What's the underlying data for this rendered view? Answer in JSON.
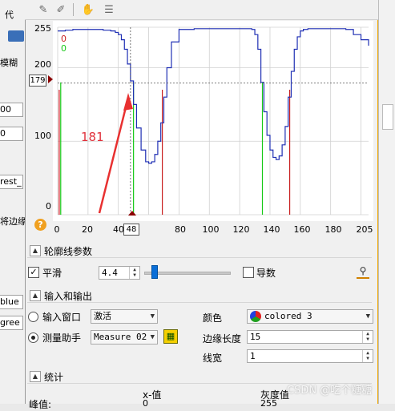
{
  "left_window": {
    "title_fragment": "代",
    "row_blur": "模糊",
    "field_1": "00",
    "field_2": "0",
    "field_3": "rest_",
    "row_edge": "将边缘",
    "field_blue": "blue",
    "field_green": "gree"
  },
  "toolbar": {
    "icons": [
      "pencil-icon",
      "eraser-icon",
      "hand-icon",
      "document-icon"
    ]
  },
  "plot": {
    "y_ticks": [
      "255",
      "200",
      "100",
      "0"
    ],
    "x_ticks": [
      "0",
      "20",
      "40",
      "60",
      "80",
      "100",
      "120",
      "140",
      "160",
      "180",
      "205"
    ],
    "y_marker_value": "179",
    "x_marker_value": "48",
    "label_red": "0",
    "label_green": "0",
    "annotation_text": "181",
    "help_icon": "help-icon",
    "colors": {
      "curve": "#1f2fb4",
      "green_line": "#16c816",
      "red_line": "#c81e1e",
      "annotation": "#e0303a",
      "arrow": "#e83030"
    }
  },
  "chart_data": {
    "type": "line",
    "xlim": [
      0,
      205
    ],
    "ylim": [
      0,
      255
    ],
    "grid": true,
    "x": [
      0,
      5,
      10,
      15,
      20,
      25,
      30,
      35,
      38,
      40,
      42,
      44,
      46,
      48,
      50,
      52,
      55,
      58,
      60,
      62,
      64,
      66,
      68,
      70,
      72,
      75,
      80,
      90,
      100,
      110,
      120,
      128,
      130,
      132,
      134,
      136,
      138,
      140,
      142,
      144,
      146,
      148,
      150,
      152,
      154,
      156,
      158,
      160,
      162,
      165,
      170,
      180,
      190,
      195,
      200,
      205
    ],
    "y": [
      250,
      251,
      252,
      252,
      252,
      252,
      251,
      250,
      248,
      245,
      238,
      225,
      205,
      182,
      150,
      118,
      88,
      72,
      70,
      72,
      82,
      100,
      125,
      160,
      200,
      235,
      252,
      253,
      253,
      253,
      253,
      252,
      245,
      225,
      180,
      140,
      108,
      88,
      78,
      75,
      80,
      95,
      120,
      160,
      195,
      225,
      242,
      250,
      252,
      253,
      253,
      253,
      252,
      245,
      238,
      230
    ],
    "green_lines_x": [
      2,
      50,
      135
    ],
    "red_lines_x": [
      1,
      69,
      153
    ]
  },
  "profile_section": {
    "title": "轮廓线参数",
    "smooth_checked": true,
    "smooth_label": "平滑",
    "smooth_value": "4.4",
    "slider_fraction": 0.12,
    "derivative_checked": false,
    "derivative_label": "导数",
    "settings_icon": "profile-settings-icon"
  },
  "io_section": {
    "title": "输入和输出",
    "input_window_label": "输入窗口",
    "input_window_value": "激活",
    "measure_label": "测量助手",
    "measure_value": "Measure 02",
    "measure_icon": "measure-tool-icon",
    "color_label": "颜色",
    "color_value": "colored 3",
    "edge_length_label": "边缘长度",
    "edge_length_value": "15",
    "line_width_label": "线宽",
    "line_width_value": "1"
  },
  "stats_section": {
    "title": "统计",
    "peak_label": "峰值:",
    "x_value_label": "x-值",
    "gray_value_label": "灰度值",
    "x_value_partial": "0",
    "gray_value_partial": "255"
  },
  "watermark": "CSDN @吃个糖糖"
}
